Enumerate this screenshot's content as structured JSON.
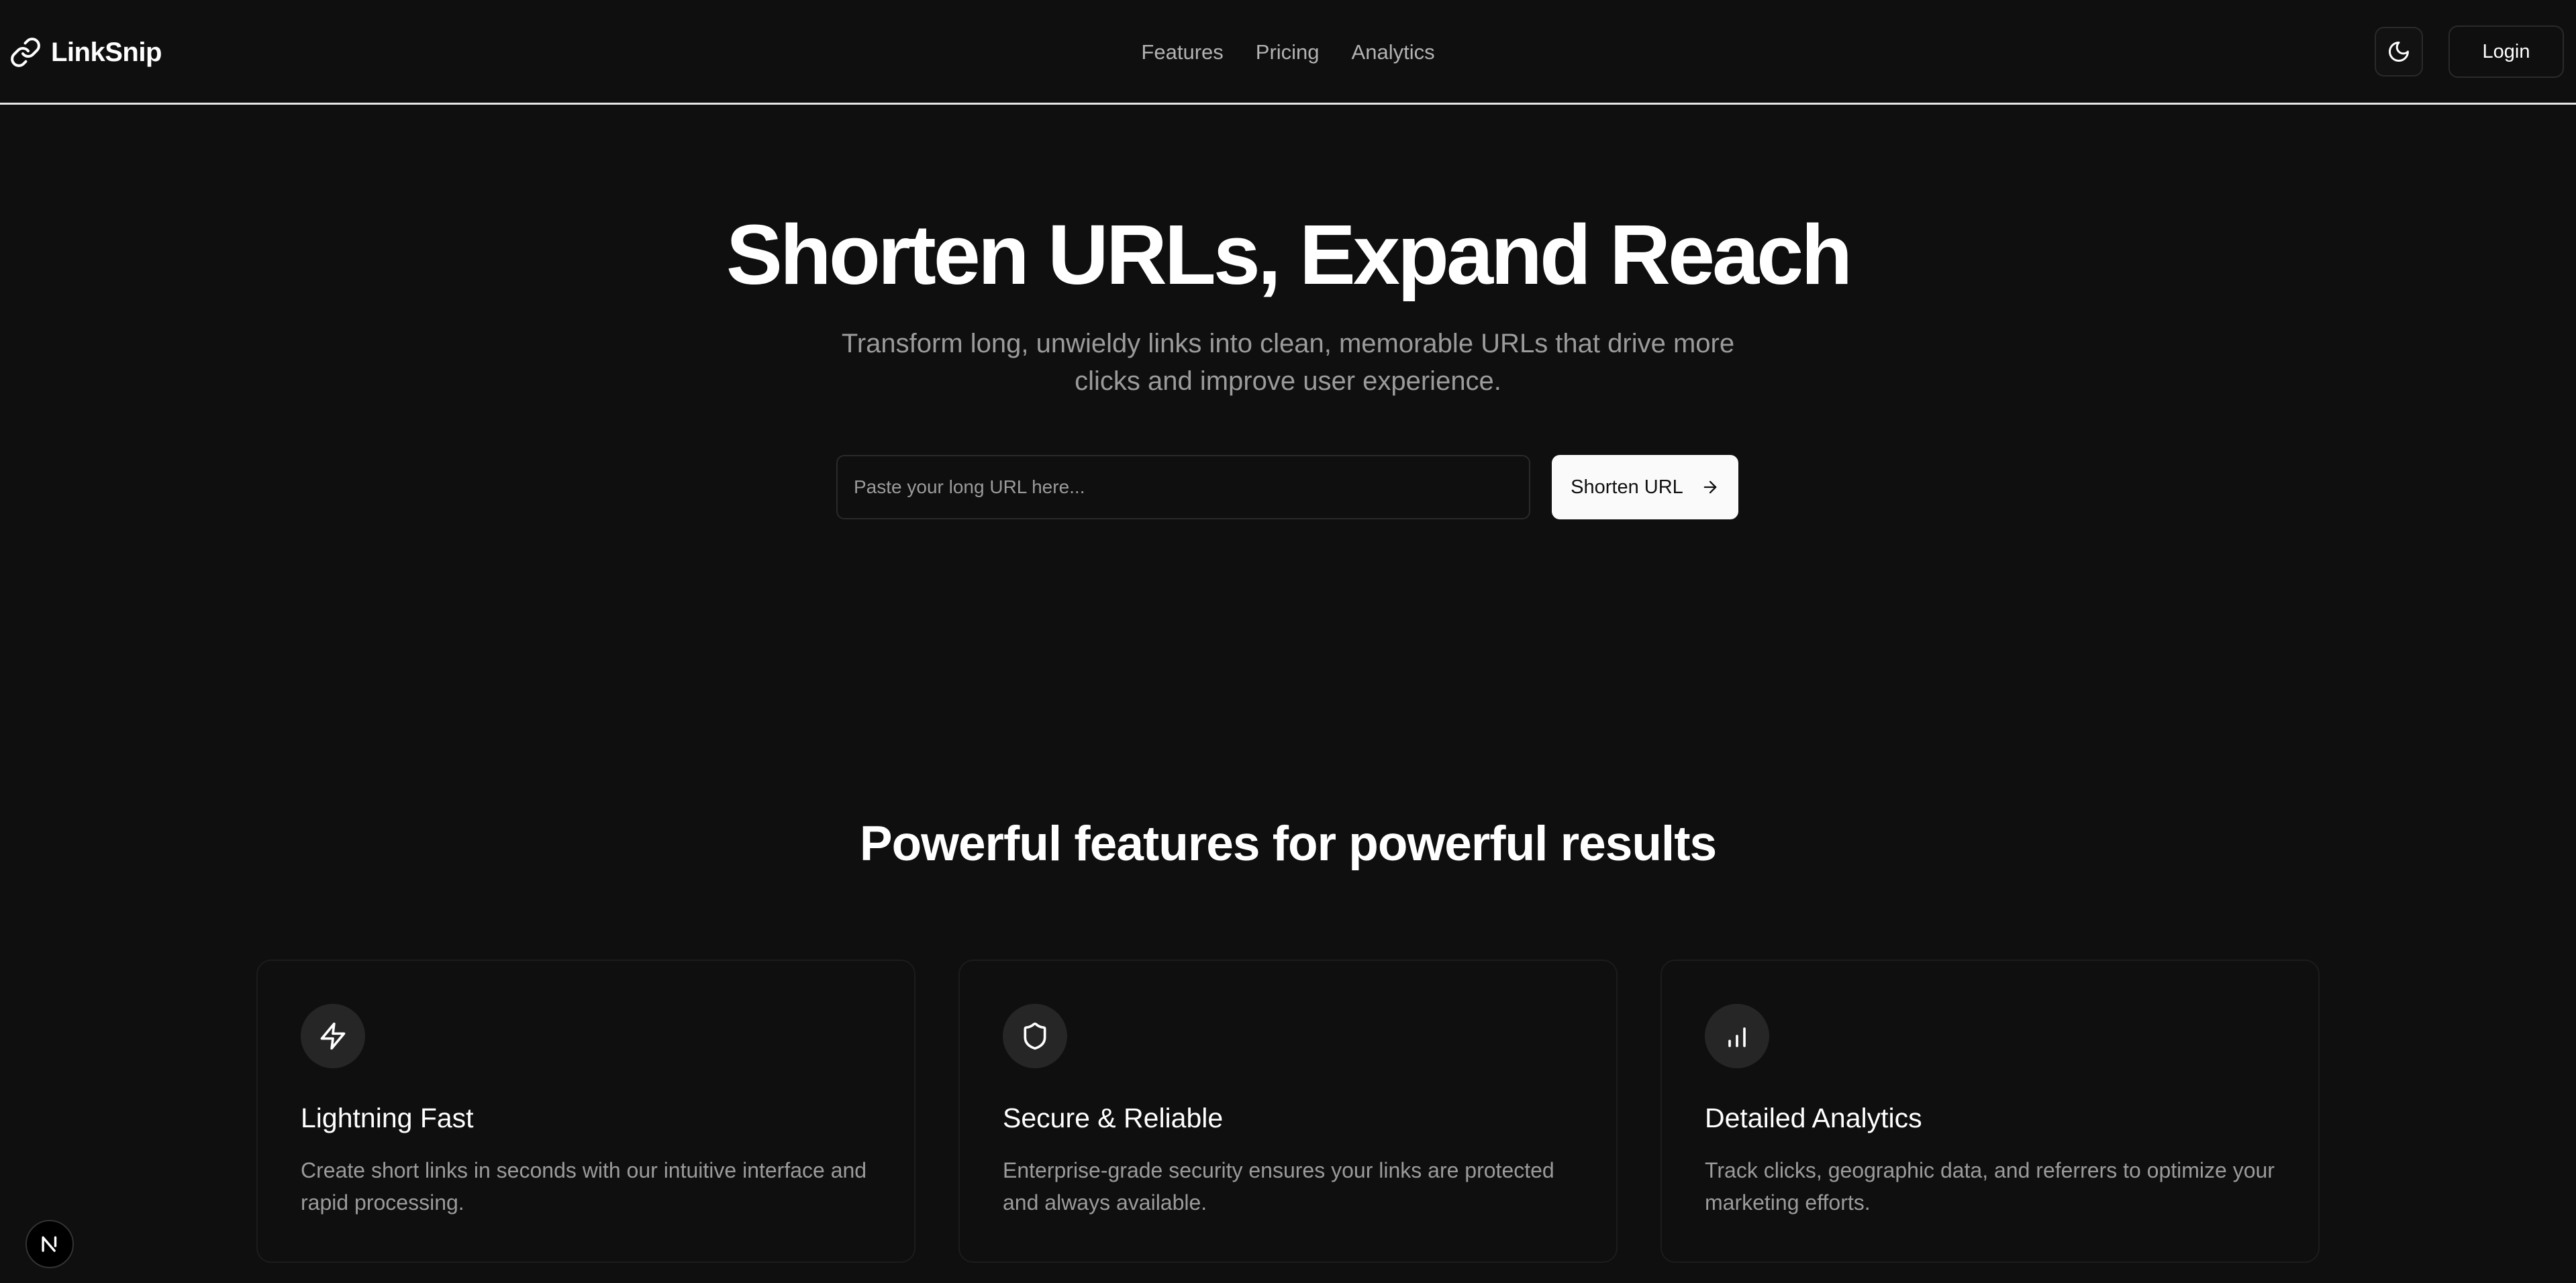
{
  "header": {
    "brand": "LinkSnip",
    "logo_icon": "link-icon",
    "nav": [
      {
        "label": "Features"
      },
      {
        "label": "Pricing"
      },
      {
        "label": "Analytics"
      }
    ],
    "theme_toggle_icon": "moon-icon",
    "login_label": "Login"
  },
  "hero": {
    "title": "Shorten URLs, Expand Reach",
    "subtitle": "Transform long, unwieldy links into clean, memorable URLs that drive more clicks and improve user experience.",
    "input_placeholder": "Paste your long URL here...",
    "input_value": "",
    "button_label": "Shorten URL",
    "button_icon": "arrow-right-icon"
  },
  "features": {
    "title": "Powerful features for powerful results",
    "cards": [
      {
        "icon": "lightning-icon",
        "title": "Lightning Fast",
        "description": "Create short links in seconds with our intuitive interface and rapid processing."
      },
      {
        "icon": "shield-icon",
        "title": "Secure & Reliable",
        "description": "Enterprise-grade security ensures your links are protected and always available."
      },
      {
        "icon": "bar-chart-icon",
        "title": "Detailed Analytics",
        "description": "Track clicks, geographic data, and referrers to optimize your marketing efforts."
      }
    ]
  },
  "badge": {
    "icon": "n-logo-icon"
  },
  "colors": {
    "background": "#0f0f0f",
    "text_primary": "#ffffff",
    "text_muted": "#9b9b9b",
    "border": "#2a2a2a",
    "button_bg": "#fafafa",
    "button_text": "#111111",
    "icon_circle": "#262626"
  }
}
